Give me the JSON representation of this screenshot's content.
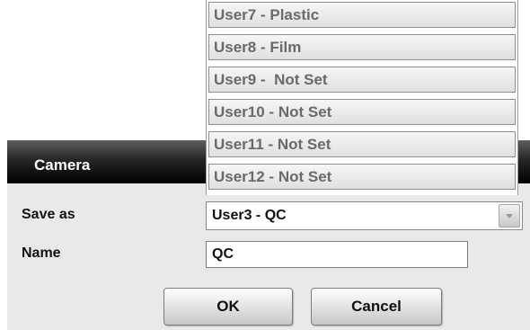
{
  "dialog": {
    "title": "Camera",
    "save_as_label": "Save as",
    "save_as_value": "User3 - QC",
    "name_label": "Name",
    "name_value": "QC",
    "ok_label": "OK",
    "cancel_label": "Cancel"
  },
  "dropdown": {
    "options": [
      "User7 - Plastic",
      "User8 - Film",
      "User9 -  Not Set",
      "User10 - Not Set",
      "User11 - Not Set",
      "User12 - Not Set"
    ]
  },
  "colors": {
    "titlebar": "#000000",
    "dialog_bg": "#e9e9e9",
    "option_text": "#6a6a6a"
  }
}
